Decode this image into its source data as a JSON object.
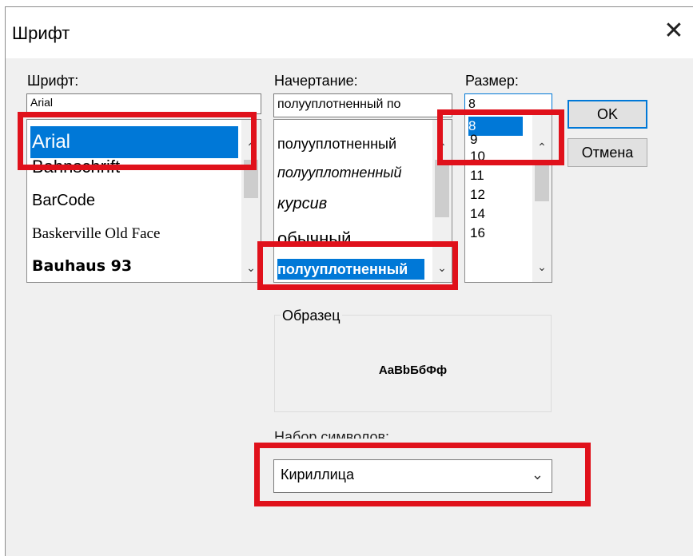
{
  "dialog": {
    "title": "Шрифт",
    "close_glyph": "✕"
  },
  "font": {
    "label": "Шрифт:",
    "value": "Arial",
    "items": [
      "Arial",
      "Bahnschrift",
      "BarCode",
      "Baskerville Old Face",
      "Bauhaus 93"
    ]
  },
  "style": {
    "label": "Начертание:",
    "value": "полууплотненный по",
    "items": [
      "полууплотненный",
      "полууплотненный",
      "курсив",
      "обычный",
      "полууплотненный"
    ]
  },
  "size": {
    "label": "Размер:",
    "value": "8",
    "items": [
      "8",
      "9",
      "10",
      "11",
      "12",
      "14",
      "16"
    ]
  },
  "buttons": {
    "ok": "OK",
    "cancel": "Отмена"
  },
  "sample": {
    "label": "Образец",
    "text": "AaBbБбФф"
  },
  "charset": {
    "label": "Набор символов:",
    "value": "Кириллица"
  },
  "colors": {
    "selection": "#0078d7",
    "highlight_box": "#e0111b"
  }
}
